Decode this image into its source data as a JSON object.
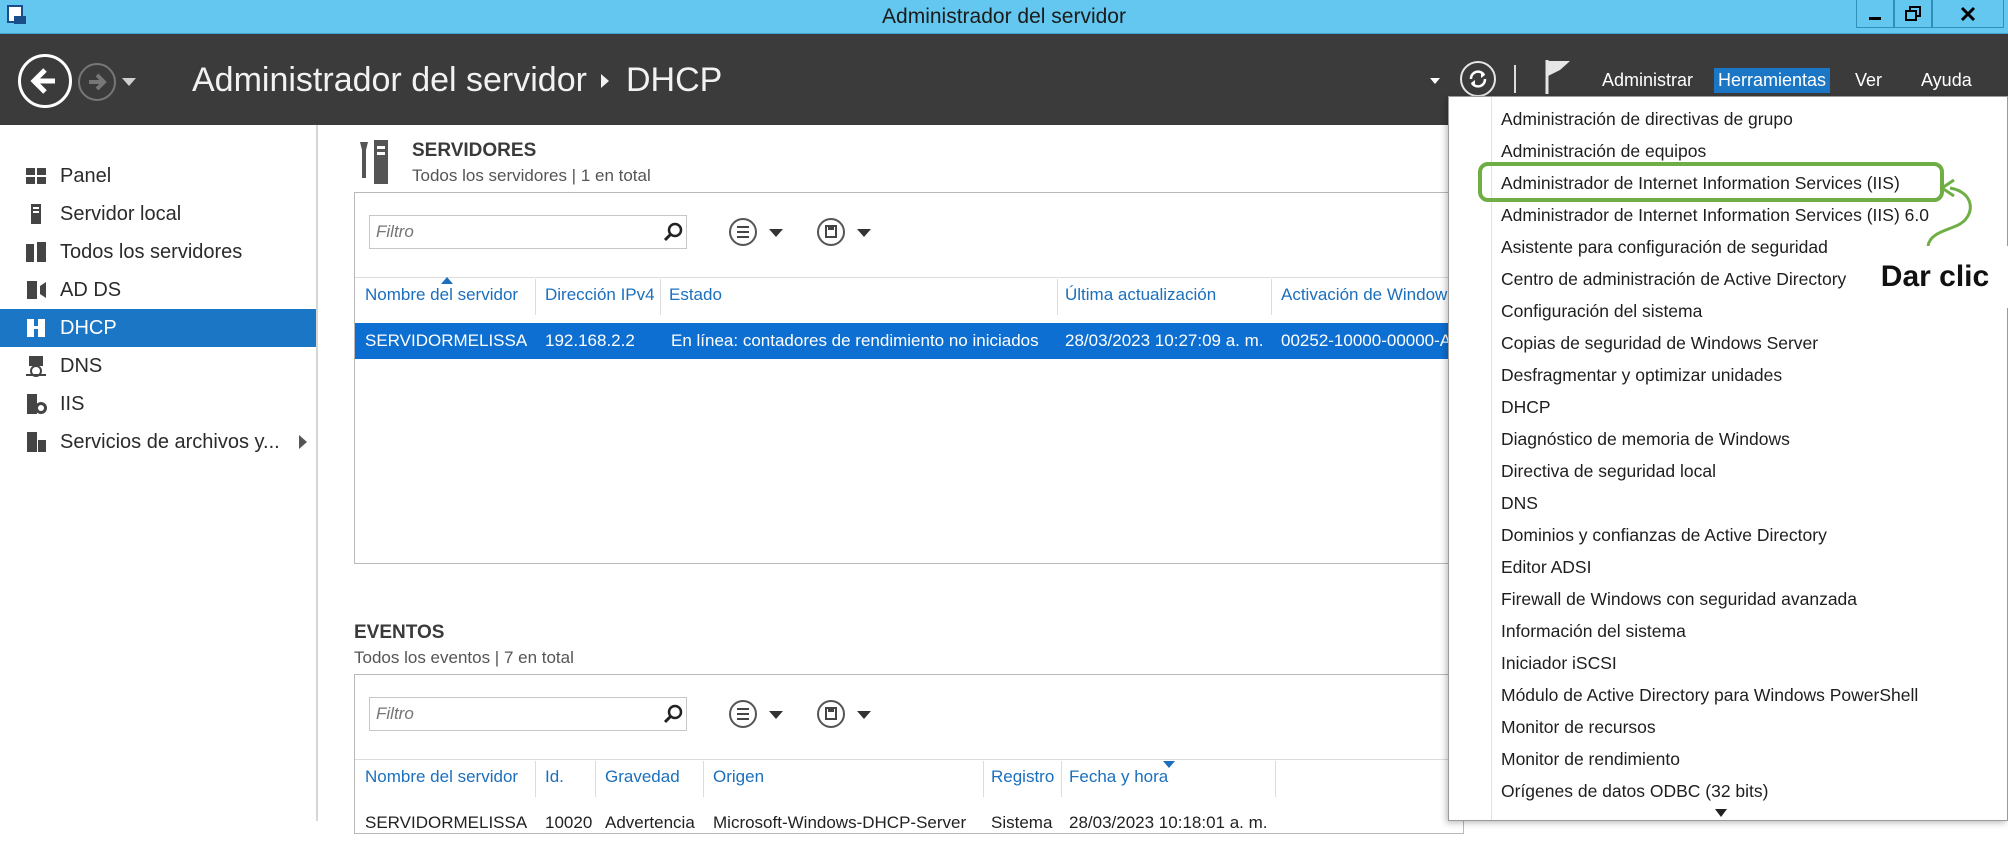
{
  "window": {
    "title": "Administrador del servidor"
  },
  "navbar": {
    "breadcrumb_root": "Administrador del servidor",
    "breadcrumb_current": "DHCP",
    "menu": [
      "Administrar",
      "Herramientas",
      "Ver",
      "Ayuda"
    ]
  },
  "sidebar": {
    "items": [
      {
        "label": "Panel",
        "icon": "dashboard-icon"
      },
      {
        "label": "Servidor local",
        "icon": "local-server-icon"
      },
      {
        "label": "Todos los servidores",
        "icon": "all-servers-icon"
      },
      {
        "label": "AD DS",
        "icon": "ad-ds-icon"
      },
      {
        "label": "DHCP",
        "icon": "dhcp-icon",
        "active": true
      },
      {
        "label": "DNS",
        "icon": "dns-icon"
      },
      {
        "label": "IIS",
        "icon": "iis-icon"
      },
      {
        "label": "Servicios de archivos y...",
        "icon": "file-services-icon"
      }
    ]
  },
  "servers": {
    "title": "SERVIDORES",
    "subtitle": "Todos los servidores | 1 en total",
    "filter_placeholder": "Filtro",
    "columns": [
      "Nombre del servidor",
      "Dirección IPv4",
      "Estado",
      "Última actualización",
      "Activación de Window"
    ],
    "rows": [
      [
        "SERVIDORMELISSA",
        "192.168.2.2",
        "En línea: contadores de rendimiento no iniciados",
        "28/03/2023 10:27:09 a. m.",
        "00252-10000-00000-A"
      ]
    ]
  },
  "events": {
    "title": "EVENTOS",
    "subtitle": "Todos los eventos | 7 en total",
    "filter_placeholder": "Filtro",
    "columns": [
      "Nombre del servidor",
      "Id.",
      "Gravedad",
      "Origen",
      "Registro",
      "Fecha y hora"
    ],
    "rows": [
      [
        "SERVIDORMELISSA",
        "10020",
        "Advertencia",
        "Microsoft-Windows-DHCP-Server",
        "Sistema",
        "28/03/2023 10:18:01 a. m."
      ]
    ]
  },
  "tools_menu": {
    "items": [
      "Administración de directivas de grupo",
      "Administración de equipos",
      "Administrador de Internet Information Services (IIS)",
      "Administrador de Internet Information Services (IIS) 6.0",
      "Asistente para configuración de seguridad",
      "Centro de administración de Active Directory",
      "Configuración del sistema",
      "Copias de seguridad de Windows Server",
      "Desfragmentar y optimizar unidades",
      "DHCP",
      "Diagnóstico de memoria de Windows",
      "Directiva de seguridad local",
      "DNS",
      "Dominios y confianzas de Active Directory",
      "Editor ADSI",
      "Firewall de Windows con seguridad avanzada",
      "Información del sistema",
      "Iniciador iSCSI",
      "Módulo de Active Directory para Windows PowerShell",
      "Monitor de recursos",
      "Monitor de rendimiento",
      "Orígenes de datos ODBC (32 bits)"
    ],
    "highlighted_index": 2
  },
  "annotation": {
    "callout": "Dar clic",
    "color": "#6fae45"
  },
  "colors": {
    "titlebar": "#63c7ef",
    "navbar": "#3b3b3b",
    "accent": "#1b76c6",
    "selection": "#0d6fd1"
  }
}
